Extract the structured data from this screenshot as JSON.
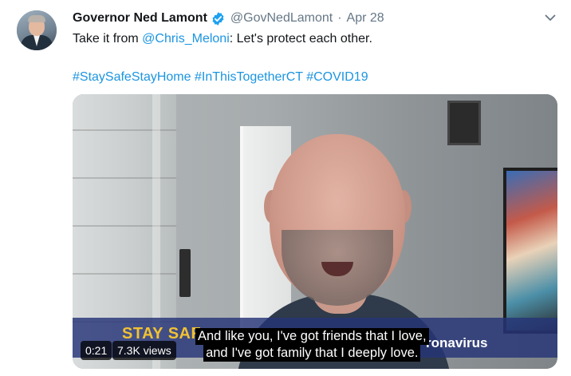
{
  "author": {
    "name": "Governor Ned Lamont",
    "handle": "@GovNedLamont",
    "separator": "·",
    "date": "Apr 28",
    "verified_color": "#1da1f2"
  },
  "tweet": {
    "line1_prefix": "Take it from ",
    "mention": "@Chris_Meloni",
    "line1_suffix": ": Let's protect each other.",
    "hashtags": [
      "#StaySafeStayHome",
      "#InThisTogetherCT",
      "#COVID19"
    ]
  },
  "video": {
    "banner_left": "STAY SAF",
    "banner_right": "ronavirus",
    "subtitle_line1": "And like you, I've got friends that I love,",
    "subtitle_line2": "and I've got family that I deeply love.",
    "time": "0:21",
    "views": "7.3K views"
  },
  "colors": {
    "link": "#1b95e0",
    "secondary_text": "#657786",
    "banner_text": "#f1c232"
  },
  "icons": {
    "verified": "verified-badge-icon",
    "menu": "chevron-down-icon"
  }
}
